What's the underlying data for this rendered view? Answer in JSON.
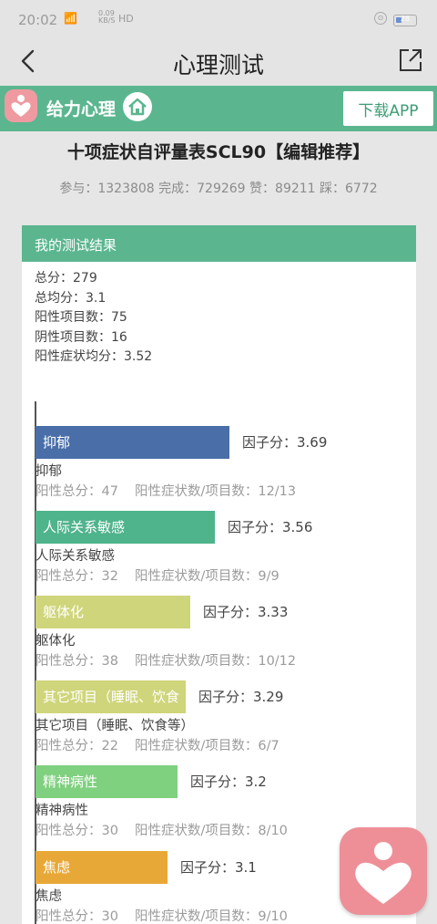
{
  "status_bar": {
    "time": "20:02",
    "signal": "📶",
    "net_speed_value": "0.09",
    "net_speed_unit": "KB/S",
    "hd_label": "HD",
    "battery_level": "28",
    "battery_fill_color": "#6a8fd0"
  },
  "nav": {
    "title": "心理测试",
    "back_icon": "chevron-left-icon",
    "share_icon": "share-icon"
  },
  "brand": {
    "name": "给力心理",
    "download_label": "下载APP",
    "color": "#5bb68f",
    "logo_color": "#ef9aa1"
  },
  "test": {
    "title": "十项症状自评量表SCL90【编辑推荐】",
    "stats": "参与：1323808 完成：729269 赞：89211 踩：6772"
  },
  "result": {
    "header": "我的测试结果",
    "lines": [
      "总分：279",
      "总均分：3.1",
      "阳性项目数：75",
      "阴性项目数：16",
      "阳性症状均分：3.52"
    ]
  },
  "factors": [
    {
      "bar_label": "抑郁",
      "score_text": "因子分：3.69",
      "name": "抑郁",
      "positive_total": "阳性总分：47",
      "ratio": "阳性症状数/项目数：12/13",
      "color": "#4a6fa8",
      "value": 3.69
    },
    {
      "bar_label": "人际关系敏感",
      "score_text": "因子分：3.56",
      "name": "人际关系敏感",
      "positive_total": "阳性总分：32",
      "ratio": "阳性症状数/项目数：9/9",
      "color": "#4fb38c",
      "value": 3.56
    },
    {
      "bar_label": "躯体化",
      "score_text": "因子分：3.33",
      "name": "躯体化",
      "positive_total": "阳性总分：38",
      "ratio": "阳性症状数/项目数：10/12",
      "color": "#cfd57a",
      "value": 3.33
    },
    {
      "bar_label": "其它项目（睡眠、饮食",
      "score_text": "因子分：3.29",
      "name": "其它项目（睡眠、饮食等）",
      "positive_total": "阳性总分：22",
      "ratio": "阳性症状数/项目数：6/7",
      "color": "#cfd57a",
      "value": 3.29
    },
    {
      "bar_label": "精神病性",
      "score_text": "因子分：3.2",
      "name": "精神病性",
      "positive_total": "阳性总分：30",
      "ratio": "阳性症状数/项目数：8/10",
      "color": "#7fd07f",
      "value": 3.2
    },
    {
      "bar_label": "焦虑",
      "score_text": "因子分：3.1",
      "name": "焦虑",
      "positive_total": "阳性总分：30",
      "ratio": "阳性症状数/项目数：9/10",
      "color": "#e8a838",
      "value": 3.1
    }
  ],
  "float_button": {
    "icon": "heart-person-icon",
    "color": "#ee8f98"
  }
}
